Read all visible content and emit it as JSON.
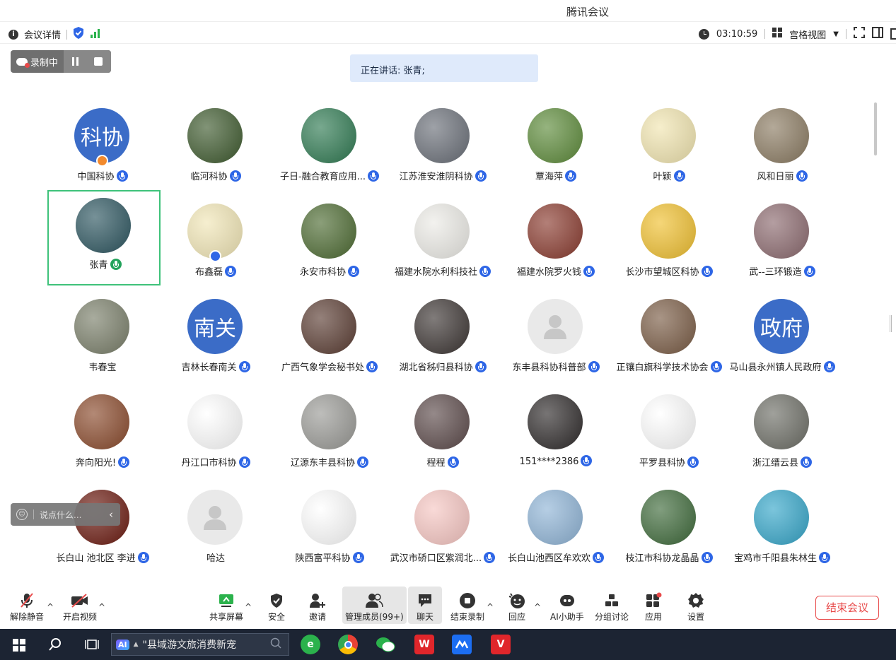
{
  "window": {
    "title": "腾讯会议"
  },
  "infobar": {
    "details_label": "会议详情",
    "timer": "03:10:59",
    "view_label": "宫格视图"
  },
  "recording": {
    "label": "录制中"
  },
  "speaking": {
    "text": "正在讲话: 张青;"
  },
  "participants": [
    {
      "name": "中国科协",
      "avatar_text": "科协",
      "bg": "#3b6cc7",
      "mic": "blue",
      "badge": "#f28a2e"
    },
    {
      "name": "临河科协",
      "avatar_text": "",
      "bg": "#3e5a2e",
      "mic": "blue"
    },
    {
      "name": "子日-融合教育应用...",
      "avatar_text": "",
      "bg": "#2f7a52",
      "mic": "blue"
    },
    {
      "name": "江苏淮安淮阴科协",
      "avatar_text": "",
      "bg": "#6a6f78",
      "mic": "blue"
    },
    {
      "name": "覃海萍",
      "avatar_text": "",
      "bg": "#5d8b3a",
      "mic": "blue"
    },
    {
      "name": "叶颖",
      "avatar_text": "",
      "bg": "#f1e5b0",
      "mic": "blue"
    },
    {
      "name": "风和日丽",
      "avatar_text": "",
      "bg": "#8b7b62",
      "mic": "blue"
    },
    {
      "name": "张青",
      "avatar_text": "",
      "bg": "#2d5660",
      "mic": "green",
      "active": true
    },
    {
      "name": "布鑫磊",
      "avatar_text": "",
      "bg": "#f1e6b6",
      "mic": "blue",
      "badge": "#2e66e6"
    },
    {
      "name": "永安市科协",
      "avatar_text": "",
      "bg": "#4d6b32",
      "mic": "blue"
    },
    {
      "name": "福建水院水利科技社",
      "avatar_text": "",
      "bg": "#ecebe6",
      "mic": "blue"
    },
    {
      "name": "福建水院罗火钱",
      "avatar_text": "",
      "bg": "#8a3b2f",
      "mic": "blue"
    },
    {
      "name": "长沙市望城区科协",
      "avatar_text": "",
      "bg": "#f0c030",
      "mic": "blue"
    },
    {
      "name": "武--三环锻造",
      "avatar_text": "",
      "bg": "#8c6a6f",
      "mic": "blue"
    },
    {
      "name": "韦春宝",
      "avatar_text": "",
      "bg": "#7a7f6a",
      "mic": ""
    },
    {
      "name": "吉林长春南关",
      "avatar_text": "南关",
      "bg": "#3b6cc7",
      "mic": "blue"
    },
    {
      "name": "广西气象学会秘书处",
      "avatar_text": "",
      "bg": "#5b3d33",
      "mic": "blue"
    },
    {
      "name": "湖北省秭归县科协",
      "avatar_text": "",
      "bg": "#3c3533",
      "mic": "blue"
    },
    {
      "name": "东丰县科协科普部",
      "avatar_text": "",
      "bg": "#e9e9e9",
      "mic": "blue"
    },
    {
      "name": "正镶白旗科学技术协会",
      "avatar_text": "",
      "bg": "#7a5c45",
      "mic": "blue"
    },
    {
      "name": "马山县永州镇人民政府",
      "avatar_text": "政府",
      "bg": "#3b6cc7",
      "mic": "blue"
    },
    {
      "name": "奔向阳光!",
      "avatar_text": "",
      "bg": "#8a4a2c",
      "mic": "blue"
    },
    {
      "name": "丹江口市科协",
      "avatar_text": "",
      "bg": "#ffffff",
      "mic": "blue"
    },
    {
      "name": "辽源东丰县科协",
      "avatar_text": "",
      "bg": "#9a9a96",
      "mic": "blue"
    },
    {
      "name": "程程",
      "avatar_text": "",
      "bg": "#5c4a4a",
      "mic": "blue"
    },
    {
      "name": "151****2386",
      "avatar_text": "",
      "bg": "#2e2a2a",
      "mic": "blue"
    },
    {
      "name": "平罗县科协",
      "avatar_text": "",
      "bg": "#ffffff",
      "mic": "blue"
    },
    {
      "name": "浙江缙云县",
      "avatar_text": "",
      "bg": "#6d6e66",
      "mic": "blue"
    },
    {
      "name": "长白山 池北区 李进",
      "avatar_text": "",
      "bg": "#6b1a10",
      "mic": "blue"
    },
    {
      "name": "哈达",
      "avatar_text": "",
      "bg": "#e9e9e9",
      "mic": ""
    },
    {
      "name": "陕西富平科协",
      "avatar_text": "",
      "bg": "#ffffff",
      "mic": "blue"
    },
    {
      "name": "武汉市硚口区紫润北...",
      "avatar_text": "",
      "bg": "#f6c6c2",
      "mic": "blue"
    },
    {
      "name": "长白山池西区牟欢欢",
      "avatar_text": "",
      "bg": "#8fb4d6",
      "mic": "blue"
    },
    {
      "name": "枝江市科协龙晶晶",
      "avatar_text": "",
      "bg": "#3e6a3a",
      "mic": "blue"
    },
    {
      "name": "宝鸡市千阳县朱林生",
      "avatar_text": "",
      "bg": "#35a6c9",
      "mic": "blue"
    }
  ],
  "chat": {
    "placeholder": "说点什么..."
  },
  "toolbar": {
    "unmute": "解除静音",
    "start_video": "开启视频",
    "share_screen": "共享屏幕",
    "security": "安全",
    "invite": "邀请",
    "manage_members": "管理成员(99+)",
    "chat": "聊天",
    "end_recording": "结束录制",
    "reactions": "回应",
    "ai_assistant": "AI小助手",
    "breakout": "分组讨论",
    "apps": "应用",
    "settings": "设置",
    "end_meeting": "结束会议"
  },
  "taskbar": {
    "search_text": "\"县域游文旅消费新宠",
    "ai_label": "AI"
  }
}
